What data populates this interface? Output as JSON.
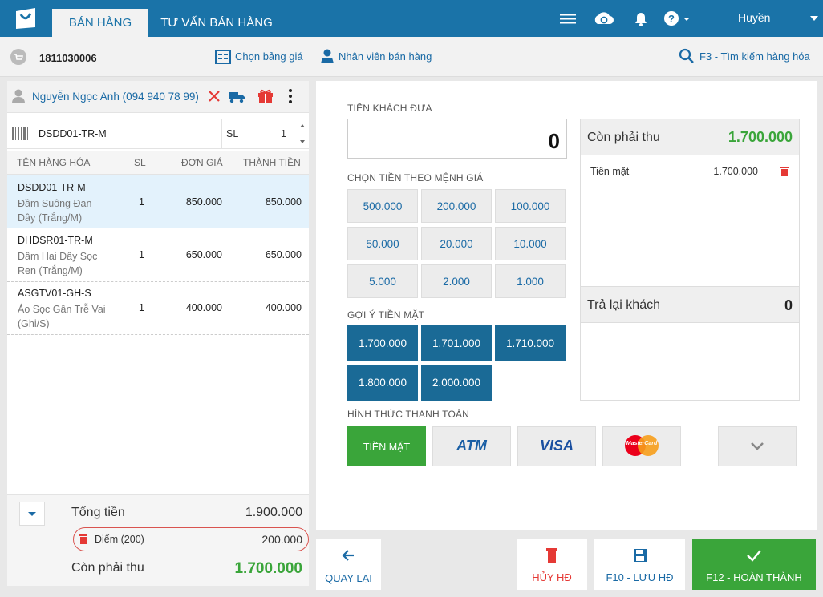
{
  "header": {
    "tabs": [
      {
        "label": "BÁN HÀNG"
      },
      {
        "label": "TƯ VẤN BÁN HÀNG"
      }
    ],
    "user": "Huyền"
  },
  "toolbar": {
    "invoice_id": "1811030006",
    "price_list_label": "Chọn bảng giá",
    "staff_label": "Nhân viên bán hàng",
    "search_label": "F3 - Tìm kiếm hàng hóa"
  },
  "customer": {
    "name": "Nguyễn Ngọc Anh (094 940 78 99)"
  },
  "item_search": {
    "code": "DSDD01-TR-M",
    "qty_label": "SL",
    "qty": "1"
  },
  "table": {
    "headers": {
      "name": "TÊN HÀNG HÓA",
      "qty": "SL",
      "price": "ĐƠN GIÁ",
      "total": "THÀNH TIỀN"
    },
    "rows": [
      {
        "code": "DSDD01-TR-M",
        "name": "Đầm Suông Đan Dây (Trắng/M)",
        "qty": "1",
        "price": "850.000",
        "total": "850.000"
      },
      {
        "code": "DHDSR01-TR-M",
        "name": "Đầm Hai Dây Sọc Ren (Trắng/M)",
        "qty": "1",
        "price": "650.000",
        "total": "650.000"
      },
      {
        "code": "ASGTV01-GH-S",
        "name": "Áo Sọc Gân Trễ Vai (Ghi/S)",
        "qty": "1",
        "price": "400.000",
        "total": "400.000"
      }
    ]
  },
  "totals": {
    "total_label": "Tổng tiền",
    "total_value": "1.900.000",
    "points_label": "Điểm (200)",
    "points_value": "200.000",
    "due_label": "Còn phải thu",
    "due_value": "1.700.000"
  },
  "payment": {
    "given_label": "TIỀN KHÁCH ĐƯA",
    "given_value": "0",
    "denom_label": "CHỌN TIỀN THEO MỆNH GIÁ",
    "denominations": [
      "500.000",
      "200.000",
      "100.000",
      "50.000",
      "20.000",
      "10.000",
      "5.000",
      "2.000",
      "1.000"
    ],
    "suggest_label": "GỢI Ý TIỀN MẶT",
    "suggestions": [
      "1.700.000",
      "1.701.000",
      "1.710.000",
      "1.800.000",
      "2.000.000"
    ],
    "method_label": "HÌNH THỨC THANH TOÁN",
    "methods": [
      "TIỀN MẶT",
      "ATM",
      "VISA",
      "MasterCard"
    ]
  },
  "summary": {
    "due_label": "Còn phải thu",
    "due_value": "1.700.000",
    "cash_label": "Tiền mặt",
    "cash_value": "1.700.000",
    "change_label": "Trả lại khách",
    "change_value": "0"
  },
  "actions": {
    "back": "QUAY LẠI",
    "cancel": "HỦY HĐ",
    "save": "F10 - LƯU HĐ",
    "complete": "F12 - HOÀN THÀNH"
  },
  "colors": {
    "primary": "#1a73a8",
    "green": "#3aa53a",
    "red": "#e53935"
  }
}
